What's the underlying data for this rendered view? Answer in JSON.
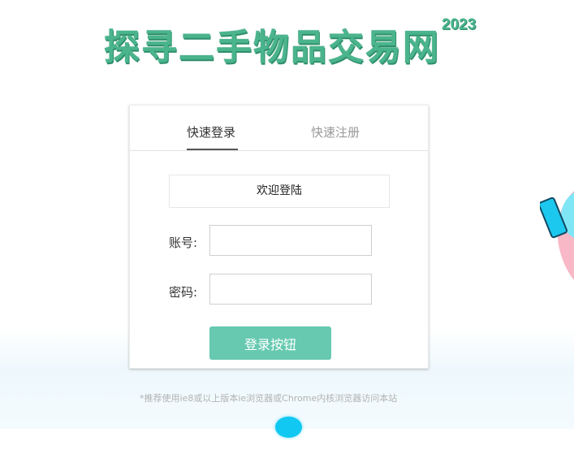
{
  "header": {
    "title": "探寻二手物品交易网",
    "year": "2023"
  },
  "login": {
    "tabs": [
      {
        "label": "快速登录",
        "active": true
      },
      {
        "label": "快速注册",
        "active": false
      }
    ],
    "welcome": "欢迎登陆",
    "account_label": "账号:",
    "account_value": "",
    "password_label": "密码:",
    "password_value": "",
    "submit_label": "登录按钮"
  },
  "footer": {
    "tip": "*推荐使用ie8或以上版本ie浏览器或Chrome内核浏览器访问本站"
  },
  "colors": {
    "brand_green": "#4ab48d",
    "button_green": "#66c9b0",
    "accent_cyan": "#10c8f2"
  }
}
